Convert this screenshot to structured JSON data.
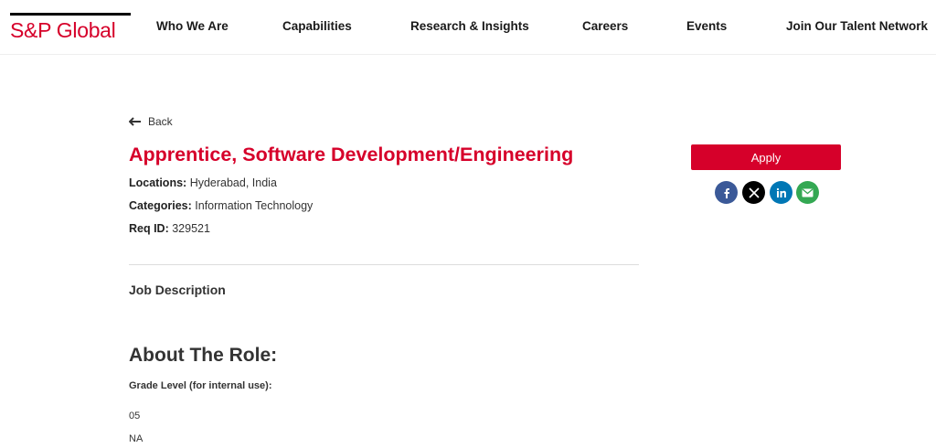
{
  "header": {
    "logo_text": "S&P Global",
    "nav": [
      "Who We Are",
      "Capabilities",
      "Research & Insights",
      "Careers",
      "Events",
      "Join Our Talent Network"
    ]
  },
  "job": {
    "back_label": "Back",
    "title": "Apprentice, Software Development/Engineering",
    "locations_label": "Locations:",
    "locations_value": "Hyderabad, India",
    "categories_label": "Categories:",
    "categories_value": "Information Technology",
    "req_label": "Req ID:",
    "req_value": "329521",
    "description_heading": "Job Description",
    "about_heading": "About The Role:",
    "grade_label": "Grade Level (for internal use):",
    "grade_value": "05",
    "na_value": "NA"
  },
  "sidebar": {
    "apply_label": "Apply",
    "share": [
      {
        "icon": "facebook-icon",
        "color": "#3b5998"
      },
      {
        "icon": "x-icon",
        "color": "#000000"
      },
      {
        "icon": "linkedin-icon",
        "color": "#0077b5"
      },
      {
        "icon": "email-icon",
        "color": "#34a853"
      }
    ]
  },
  "colors": {
    "brand_red": "#d6002a",
    "text": "#333333"
  }
}
